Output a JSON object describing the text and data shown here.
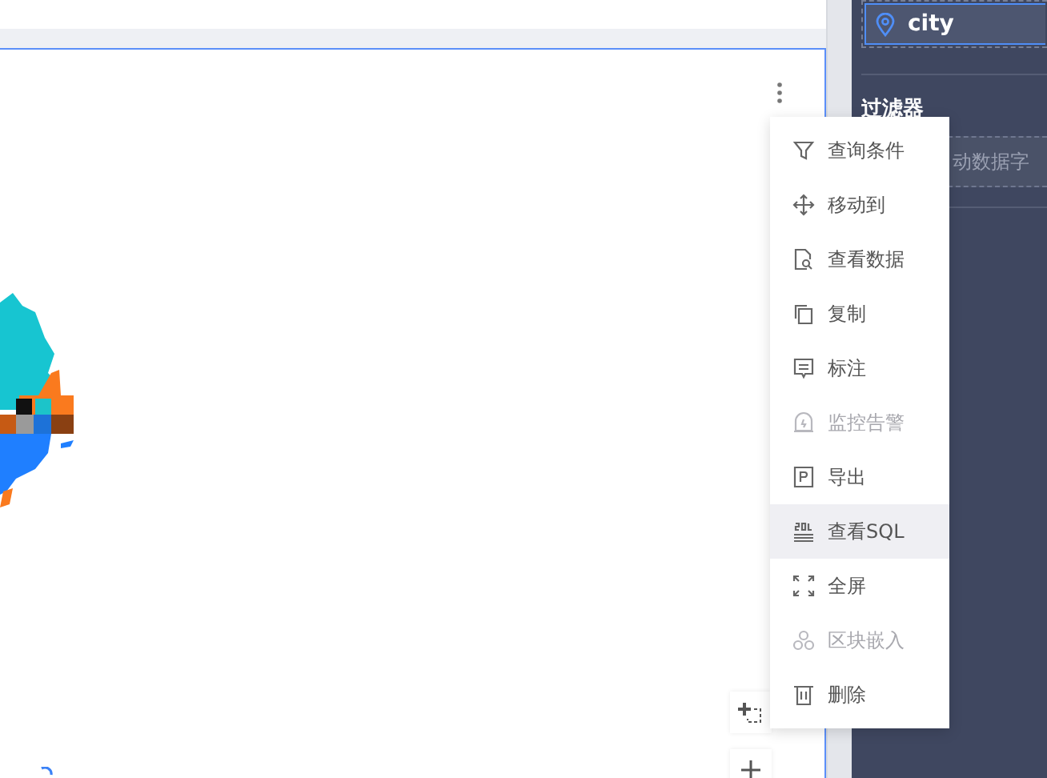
{
  "zoom_controls": [
    {
      "kind": "fit"
    },
    {
      "kind": "plus"
    }
  ],
  "context_menu": {
    "items": [
      {
        "kind": "filter",
        "label": "查询条件",
        "disabled": false,
        "selected": false
      },
      {
        "kind": "move",
        "label": "移动到",
        "disabled": false,
        "selected": false
      },
      {
        "kind": "view",
        "label": "查看数据",
        "disabled": false,
        "selected": false
      },
      {
        "kind": "copy",
        "label": "复制",
        "disabled": false,
        "selected": false
      },
      {
        "kind": "note",
        "label": "标注",
        "disabled": false,
        "selected": false
      },
      {
        "kind": "alarm",
        "label": "监控告警",
        "disabled": true,
        "selected": false
      },
      {
        "kind": "export",
        "label": "导出",
        "disabled": false,
        "selected": false
      },
      {
        "kind": "sql",
        "label": "查看SQL",
        "disabled": false,
        "selected": true
      },
      {
        "kind": "fullscreen",
        "label": "全屏",
        "disabled": false,
        "selected": false
      },
      {
        "kind": "embed",
        "label": "区块嵌入",
        "disabled": true,
        "selected": false
      },
      {
        "kind": "delete",
        "label": "删除",
        "disabled": false,
        "selected": false
      }
    ]
  },
  "side_panel": {
    "dimension_field": {
      "label": "city"
    },
    "filter": {
      "title": "过滤器",
      "placeholder": "动数据字"
    }
  }
}
